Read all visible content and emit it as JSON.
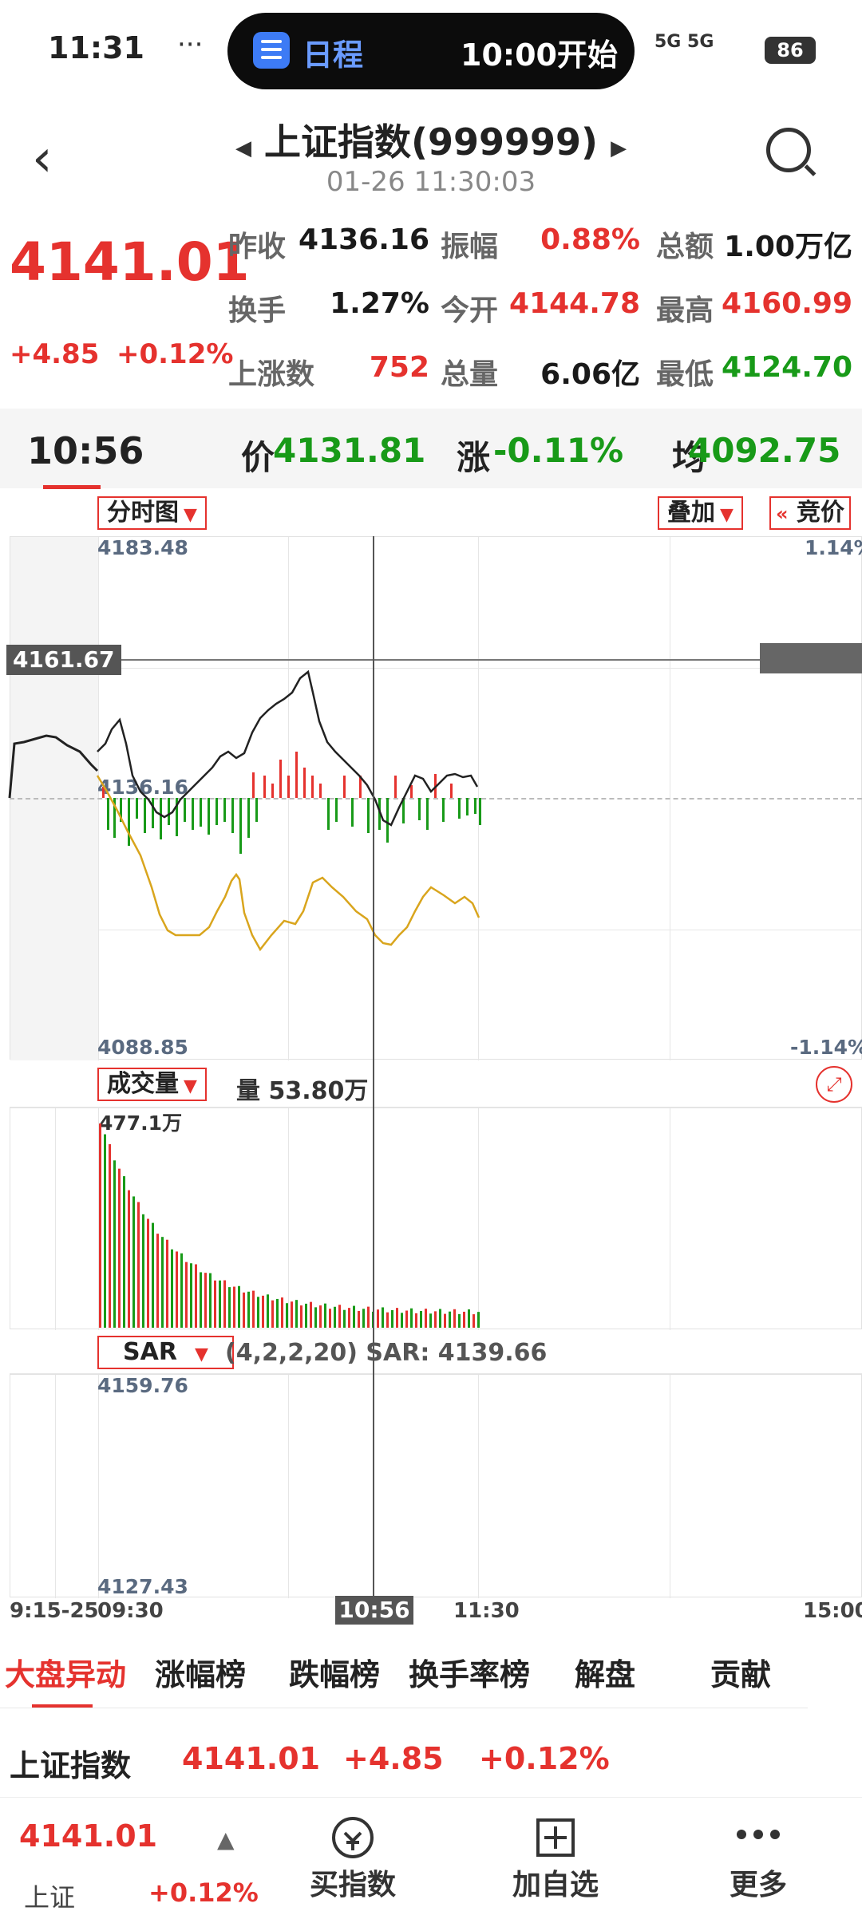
{
  "status_bar": {
    "time": "11:31",
    "dots": "···",
    "pill_title": "日程",
    "pill_time": "10:00开始",
    "signal": "5G 5G",
    "battery": "86"
  },
  "header": {
    "title": "上证指数(999999)",
    "datetime": "01-26 11:30:03"
  },
  "quote": {
    "price": "4141.01",
    "change": "+4.85",
    "change_pct": "+0.12%",
    "stats": [
      {
        "label": "昨收",
        "value": "4136.16",
        "color": "#1a1a1a"
      },
      {
        "label": "振幅",
        "value": "0.88%",
        "color": "#e5322e"
      },
      {
        "label": "总额",
        "value": "1.00万亿",
        "color": "#1a1a1a"
      },
      {
        "label": "换手",
        "value": "1.27%",
        "color": "#1a1a1a"
      },
      {
        "label": "今开",
        "value": "4144.78",
        "color": "#e5322e"
      },
      {
        "label": "最高",
        "value": "4160.99",
        "color": "#e5322e"
      },
      {
        "label": "上涨数",
        "value": "752",
        "color": "#e5322e"
      },
      {
        "label": "总量",
        "value": "6.06亿",
        "color": "#1a1a1a"
      },
      {
        "label": "最低",
        "value": "4124.70",
        "color": "#189a18"
      }
    ]
  },
  "tick": {
    "time": "10:56",
    "price_label": "价",
    "price": "4131.81",
    "change_label": "涨",
    "change": "-0.11%",
    "avg_label": "均",
    "avg": "4092.75"
  },
  "chart": {
    "main_dropdown": "分时图",
    "overlay_button": "叠加",
    "auction_button": "竞价",
    "y_top": "4183.48",
    "y_mid": "4136.16",
    "y_bottom": "4088.85",
    "pct_top": "1.14%",
    "pct_bottom": "-1.14%",
    "crosshair_price": "4161.67",
    "volume_dropdown": "成交量",
    "volume_text": "量 53.80万",
    "volume_max": "477.1万",
    "sar_dropdown": "SAR",
    "sar_text": "(4,2,2,20) SAR: 4139.66",
    "sar_top": "4159.76",
    "sar_bottom": "4127.43",
    "time_axis": [
      "9:15-25",
      "09:30",
      "11:30",
      "15:00"
    ],
    "crosshair_time": "10:56"
  },
  "chart_data": {
    "type": "line",
    "title": "",
    "ylim": [
      4088.85,
      4183.48
    ],
    "prev_close": 4136.16,
    "x_range": [
      "09:30",
      "15:00"
    ],
    "series": [],
    "volume_max_label": "477.1万"
  },
  "tabs": [
    {
      "label": "大盘异动",
      "active": true
    },
    {
      "label": "涨幅榜",
      "active": false
    },
    {
      "label": "跌幅榜",
      "active": false
    },
    {
      "label": "换手率榜",
      "active": false
    },
    {
      "label": "解盘",
      "active": false
    },
    {
      "label": "贡献",
      "active": false
    }
  ],
  "index_row": {
    "name": "上证指数",
    "price": "4141.01",
    "change": "+4.85",
    "pct": "+0.12%"
  },
  "bottom_bar": {
    "price": "4141.01",
    "name": "上证",
    "pct": "+0.12%",
    "buttons": [
      {
        "label": "买指数",
        "icon": "buy-index-icon"
      },
      {
        "label": "加自选",
        "icon": "add-watchlist-icon"
      },
      {
        "label": "更多",
        "icon": "more-icon"
      }
    ]
  },
  "colors": {
    "up": "#e5322e",
    "down": "#189a18",
    "avg_line": "#d9a51d",
    "price_line": "#222222"
  }
}
